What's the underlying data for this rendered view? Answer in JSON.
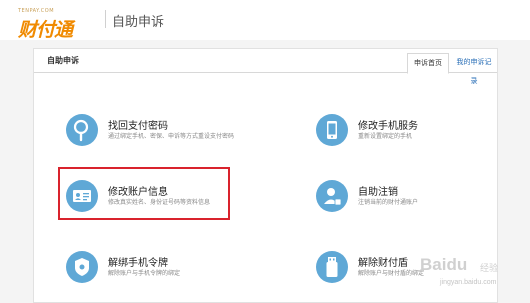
{
  "header": {
    "logo_caption": "TENPAY.COM",
    "logo_text": "财付通",
    "title": "自助申诉"
  },
  "panel": {
    "title": "自助申诉",
    "tabs": [
      {
        "label": "申诉首页",
        "active": true
      },
      {
        "label": "我的申诉记录",
        "active": false
      }
    ]
  },
  "items": [
    {
      "title": "找回支付密码",
      "desc": "通过绑定手机、密保、申诉等方式重设支付密码",
      "icon": "magnifier-icon"
    },
    {
      "title": "修改手机服务",
      "desc": "重新设置绑定的手机",
      "icon": "phone-icon"
    },
    {
      "title": "修改账户信息",
      "desc": "修改真实姓名、身份证号码等资料信息",
      "icon": "id-card-icon"
    },
    {
      "title": "自助注销",
      "desc": "注销当前的财付通账户",
      "icon": "user-logout-icon"
    },
    {
      "title": "解绑手机令牌",
      "desc": "解除账户与手机令牌的绑定",
      "icon": "shield-token-icon"
    },
    {
      "title": "解除财付盾",
      "desc": "解除账户与财付盾的绑定",
      "icon": "usb-key-icon"
    }
  ],
  "watermark": {
    "logo": "Baidu",
    "sub": "经验",
    "url": "jingyan.baidu.com"
  },
  "colors": {
    "brand_orange": "#f08a00",
    "icon_blue": "#5fa8d6",
    "link_blue": "#2a6fb7",
    "highlight_red": "#d9232d"
  }
}
